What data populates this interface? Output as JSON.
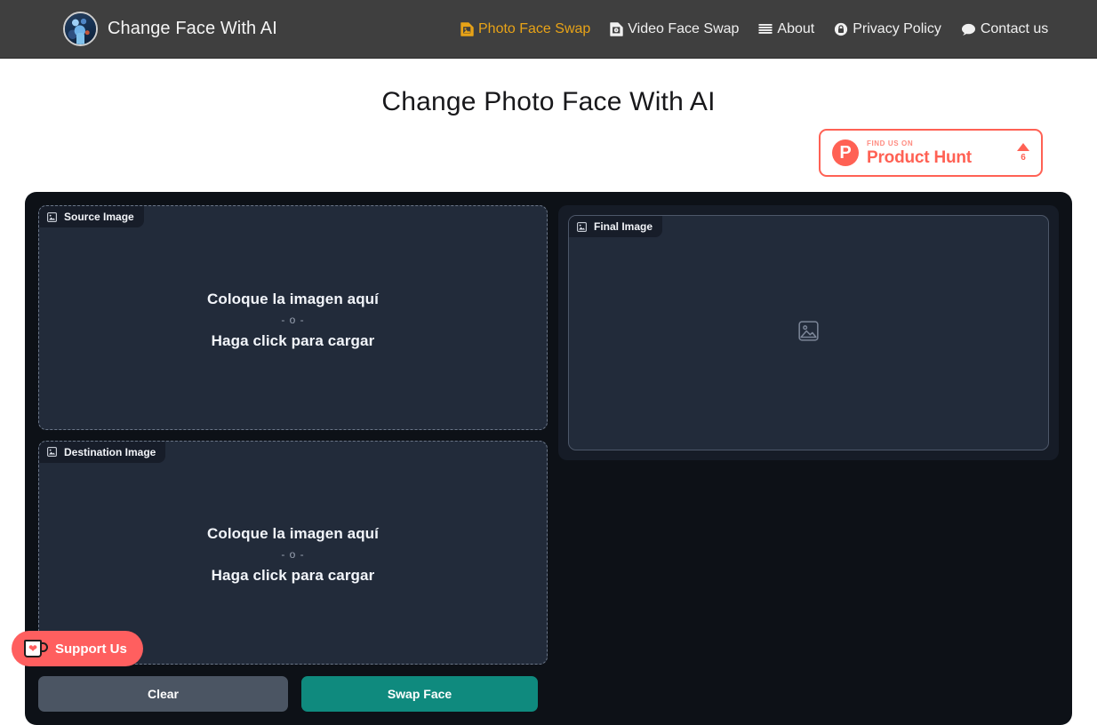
{
  "header": {
    "brand_name": "Change Face With AI",
    "avatar_icon": "ai-face-avatar",
    "nav": [
      {
        "label": "Photo Face Swap",
        "icon": "file-image-icon",
        "active": true
      },
      {
        "label": "Video Face Swap",
        "icon": "file-video-icon",
        "active": false
      },
      {
        "label": "About",
        "icon": "list-bars-icon",
        "active": false
      },
      {
        "label": "Privacy Policy",
        "icon": "lock-circle-icon",
        "active": false
      },
      {
        "label": "Contact us",
        "icon": "speech-bubble-icon",
        "active": false
      }
    ]
  },
  "page": {
    "title": "Change Photo Face With AI"
  },
  "product_hunt": {
    "subtitle": "FIND US ON",
    "title": "Product Hunt",
    "logo_letter": "P",
    "upvote_icon": "triangle-up-icon",
    "upvote_count": "6",
    "accent_color": "#ff6154"
  },
  "panels": {
    "source": {
      "tag_label": "Source Image",
      "tag_icon": "image-placeholder-icon",
      "drop_text": "Coloque la imagen aquí",
      "or_text": "- o -",
      "click_text": "Haga click para cargar"
    },
    "destination": {
      "tag_label": "Destination Image",
      "tag_icon": "image-placeholder-icon",
      "drop_text": "Coloque la imagen aquí",
      "or_text": "- o -",
      "click_text": "Haga click para cargar"
    },
    "final": {
      "tag_label": "Final Image",
      "tag_icon": "image-placeholder-icon",
      "placeholder_icon": "image-placeholder-icon"
    }
  },
  "actions": {
    "clear_label": "Clear",
    "clear_color": "#4b5563",
    "swap_label": "Swap Face",
    "swap_color": "#0f8a7e"
  },
  "support": {
    "label": "Support Us",
    "icon": "coffee-cup-heart-icon",
    "color": "#ff5f5f"
  }
}
